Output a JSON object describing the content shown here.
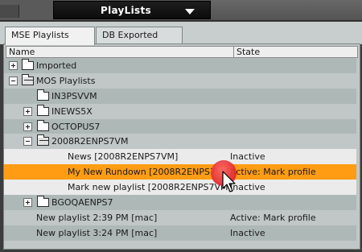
{
  "window": {
    "title": "PlayLists"
  },
  "tabs": [
    {
      "label": "MSE Playlists",
      "active": true
    },
    {
      "label": "DB Exported",
      "active": false
    }
  ],
  "table": {
    "columns": {
      "name": "Name",
      "state": "State"
    },
    "rows": [
      {
        "label": "Imported",
        "state": "",
        "expander": "plus",
        "folder": "closed"
      },
      {
        "label": "MOS Playlists",
        "state": "",
        "expander": "minus",
        "folder": "open"
      },
      {
        "label": "IN3PSVVM",
        "state": "",
        "expander": "none",
        "folder": "closed"
      },
      {
        "label": "INEWS5X",
        "state": "",
        "expander": "plus",
        "folder": "closed"
      },
      {
        "label": "OCTOPUS7",
        "state": "",
        "expander": "plus",
        "folder": "closed"
      },
      {
        "label": "2008R2ENPS7VM",
        "state": "",
        "expander": "minus",
        "folder": "open"
      },
      {
        "label": "News [2008R2ENPS7VM]",
        "state": "Inactive"
      },
      {
        "label": "My New Rundown [2008R2ENPS7VM]",
        "state": "Active: Mark profile",
        "selected": true
      },
      {
        "label": "Mark new playlist [2008R2ENPS7VM]",
        "state": "Inactive"
      },
      {
        "label": "BGOQAENPS7",
        "state": "",
        "expander": "plus",
        "folder": "closed"
      },
      {
        "label": "New playlist 2:39 PM [mac]",
        "state": "Active: Mark profile"
      },
      {
        "label": "New playlist 3:24 PM [mac]",
        "state": "Inactive"
      }
    ]
  },
  "colors": {
    "selection": "#ff9c13",
    "cursor_highlight": "#e0222a"
  }
}
